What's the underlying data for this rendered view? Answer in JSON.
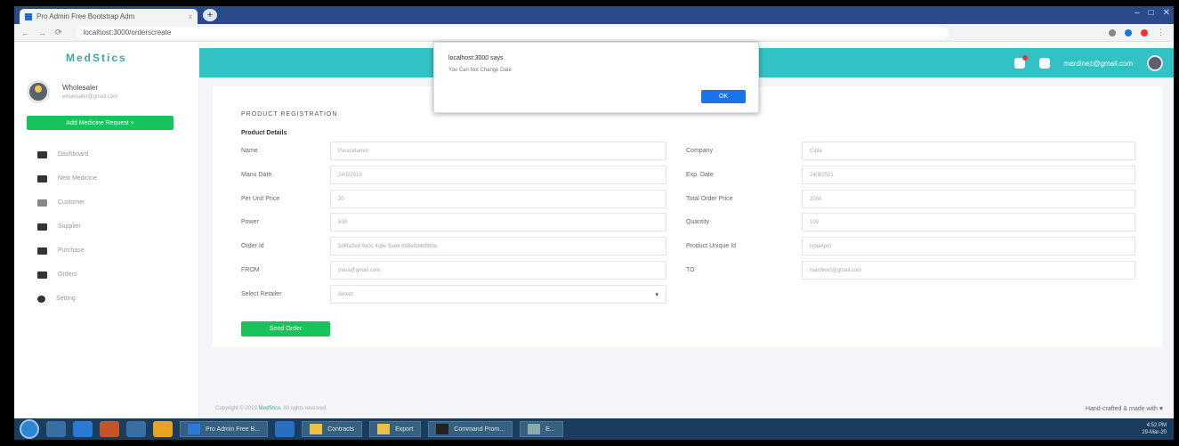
{
  "browser": {
    "tab_title": "Pro Admin Free Bootstrap Adm",
    "tab_close": "x",
    "new_tab": "+",
    "url": "localhost:3000/orderscreate",
    "window_controls": [
      "–",
      "□",
      "✕"
    ]
  },
  "app": {
    "logo": "MedStics",
    "user_name": "Wholesaler",
    "user_email": "wholesaler@gmail.com",
    "add_button": "Add Medicine Request +",
    "menu": [
      "Dashboard",
      "New Medicine",
      "Customer",
      "Supplier",
      "Purchase",
      "Orders",
      "Setting"
    ],
    "topbar_email": "mardinez@gmail.com"
  },
  "form": {
    "heading": "PRODUCT REGISTRATION",
    "subheading": "Product Details",
    "left": [
      {
        "label": "Name",
        "value": "Paracetamol"
      },
      {
        "label": "Manu Date",
        "value": "24/5/2019"
      },
      {
        "label": "Per Unit Price",
        "value": "20"
      },
      {
        "label": "Power",
        "value": "500"
      },
      {
        "label": "Order Id",
        "value": "5d6fa3e8 9a0c 4c6e 9ae6 d98e8d4d5b9e"
      },
      {
        "label": "FROM",
        "value": "mara@gmail.com"
      }
    ],
    "right": [
      {
        "label": "Company",
        "value": "Cipla"
      },
      {
        "label": "Exp. Date",
        "value": "24/5/2021"
      },
      {
        "label": "Total Order Price",
        "value": "2000"
      },
      {
        "label": "Quantity",
        "value": "100"
      },
      {
        "label": "Product Unique Id",
        "value": "cipla4pm"
      },
      {
        "label": "TO",
        "value": "mardinez@gmail.com"
      }
    ],
    "select_label": "Select Retailer",
    "select_value": "Select",
    "send_button": "Send Order"
  },
  "footer": {
    "left_prefix": "Copyright © 2019 ",
    "left_brand": "MedStics",
    "left_suffix": ". All rights reserved.",
    "right": "Hand-crafted & made with ♥"
  },
  "dialog": {
    "title": "localhost:3000 says",
    "message": "You Can Not Change Date",
    "ok": "OK"
  },
  "taskbar": {
    "items": [
      "Pro Admin Free B...",
      "Contracts",
      "Export",
      "Command Prom...",
      "E..."
    ],
    "time": "4:52 PM",
    "date": "29-Mar-20"
  },
  "colors": {
    "accent": "#33c2c4",
    "green": "#16c45b",
    "dialog_ok": "#1a73e8"
  }
}
